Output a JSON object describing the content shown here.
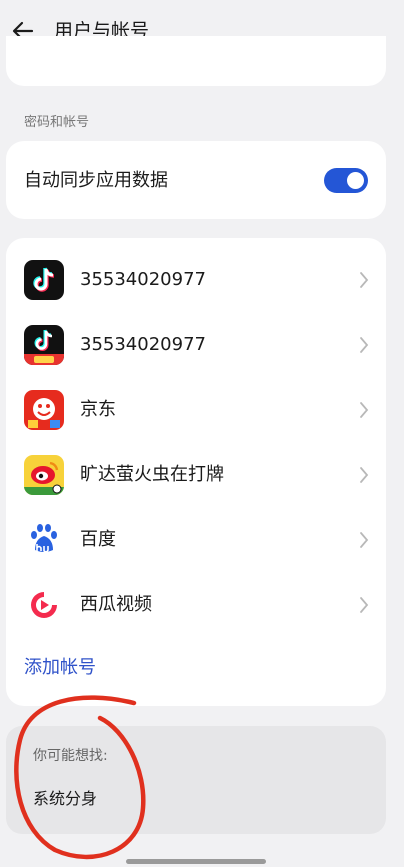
{
  "header": {
    "title": "用户与帐号",
    "back_icon": "arrow-left-icon"
  },
  "section": {
    "label": "密码和帐号"
  },
  "sync": {
    "label": "自动同步应用数据",
    "enabled": true,
    "accent": "#2456d6"
  },
  "accounts": [
    {
      "label": "35534020977",
      "icon": "douyin-icon"
    },
    {
      "label": "35534020977",
      "icon": "douyin-lite-icon"
    },
    {
      "label": "京东",
      "icon": "jd-icon"
    },
    {
      "label": "旷达萤火虫在打牌",
      "icon": "weibo-icon"
    },
    {
      "label": "百度",
      "icon": "baidu-icon"
    },
    {
      "label": "西瓜视频",
      "icon": "xigua-icon"
    }
  ],
  "add_account": {
    "label": "添加帐号",
    "color": "#2f52c9"
  },
  "suggest": {
    "title": "你可能想找:",
    "items": [
      "系统分身"
    ]
  },
  "annotation_color": "#e0301e"
}
